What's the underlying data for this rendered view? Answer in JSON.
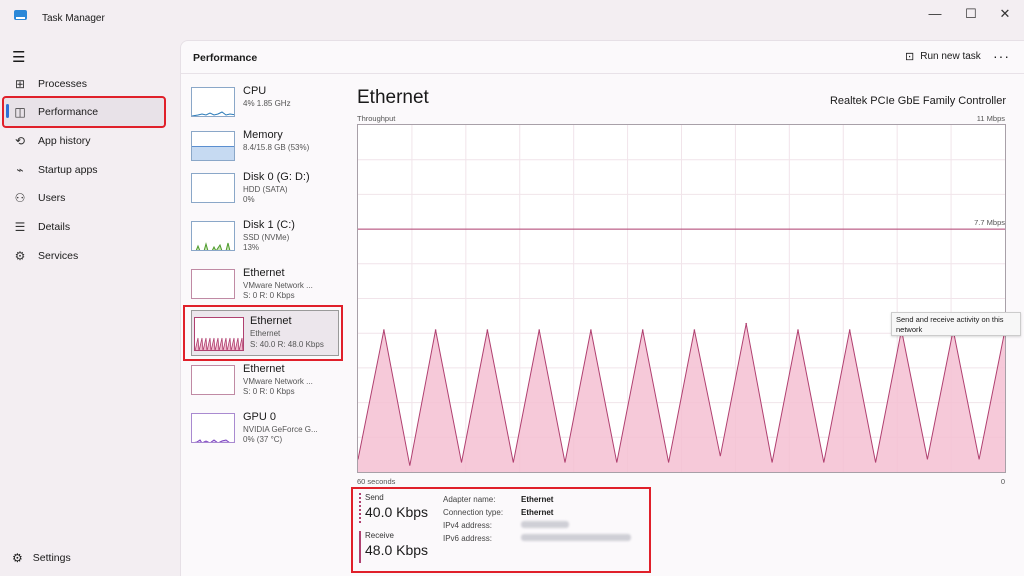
{
  "app": {
    "title": "Task Manager",
    "window_controls": [
      "—",
      "☐",
      "✕"
    ]
  },
  "sidebar": {
    "items": [
      {
        "label": "Processes",
        "icon": "processes-icon",
        "glyph": "⊞"
      },
      {
        "label": "Performance",
        "icon": "performance-icon",
        "glyph": "◫",
        "active": true
      },
      {
        "label": "App history",
        "icon": "history-icon",
        "glyph": "⟲"
      },
      {
        "label": "Startup apps",
        "icon": "startup-icon",
        "glyph": "⌁"
      },
      {
        "label": "Users",
        "icon": "users-icon",
        "glyph": "⚇"
      },
      {
        "label": "Details",
        "icon": "details-icon",
        "glyph": "☰"
      },
      {
        "label": "Services",
        "icon": "services-icon",
        "glyph": "⚙"
      }
    ],
    "settings_label": "Settings"
  },
  "header": {
    "title": "Performance",
    "run_new_task": "Run new task",
    "more": "···"
  },
  "devices": [
    {
      "name": "CPU",
      "line1": "4%  1.85 GHz",
      "line2": "",
      "color": "#2b7bb9"
    },
    {
      "name": "Memory",
      "line1": "8.4/15.8 GB (53%)",
      "line2": "",
      "color": "#5b8fd0"
    },
    {
      "name": "Disk 0 (G: D:)",
      "line1": "HDD (SATA)",
      "line2": "0%",
      "color": "#4c9a2a"
    },
    {
      "name": "Disk 1 (C:)",
      "line1": "SSD (NVMe)",
      "line2": "13%",
      "color": "#4c9a2a"
    },
    {
      "name": "Ethernet",
      "line1": "VMware Network ...",
      "line2": "S: 0  R: 0 Kbps",
      "color": "#b04070"
    },
    {
      "name": "Ethernet",
      "line1": "Ethernet",
      "line2": "S: 40.0  R: 48.0 Kbps",
      "color": "#b04070",
      "selected": true
    },
    {
      "name": "Ethernet",
      "line1": "VMware Network ...",
      "line2": "S: 0  R: 0 Kbps",
      "color": "#b04070"
    },
    {
      "name": "GPU 0",
      "line1": "NVIDIA GeForce G...",
      "line2": "0%  (37 °C)",
      "color": "#7a3fc0"
    }
  ],
  "detail": {
    "title": "Ethernet",
    "adapter": "Realtek PCIe GbE Family Controller",
    "throughput_label": "Throughput",
    "max_label": "11 Mbps",
    "mid_label": "7.7 Mbps",
    "time_label": "60 seconds",
    "zero_label": "0",
    "tooltip": "Send and receive activity on this network"
  },
  "chart_data": {
    "type": "area",
    "ylim": [
      0,
      11
    ],
    "reference_line": 7.7,
    "series": [
      {
        "name": "Receive",
        "color": "#b04070",
        "values": [
          0.4,
          4.5,
          0.2,
          4.5,
          0.3,
          4.5,
          0.3,
          4.5,
          0.3,
          4.5,
          0.3,
          4.5,
          0.3,
          4.5,
          0.5,
          4.7,
          0.3,
          4.5,
          0.3,
          4.5,
          0.3,
          4.5,
          0.4,
          4.5,
          0.4,
          4.5
        ]
      }
    ]
  },
  "stats": {
    "send_label": "Send",
    "send_value": "40.0 Kbps",
    "receive_label": "Receive",
    "receive_value": "48.0 Kbps",
    "adapter_name_label": "Adapter name:",
    "adapter_name_value": "Ethernet",
    "connection_type_label": "Connection type:",
    "connection_type_value": "Ethernet",
    "ipv4_label": "IPv4 address:",
    "ipv6_label": "IPv6 address:"
  }
}
